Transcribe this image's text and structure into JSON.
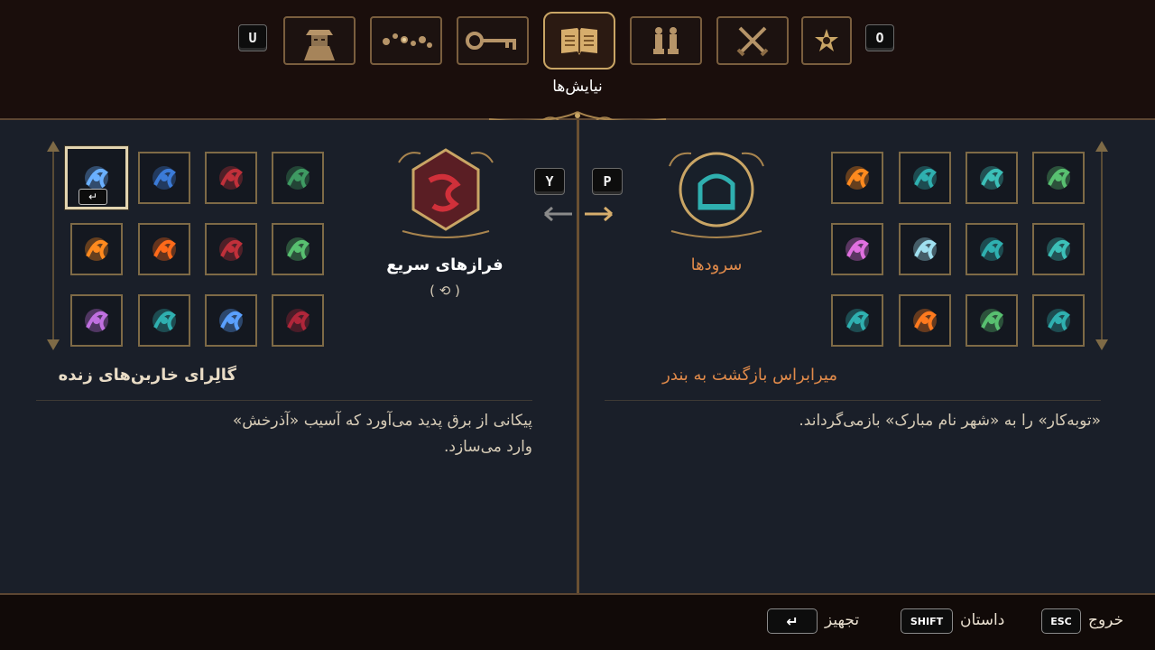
{
  "top_nav": {
    "left_key": "U",
    "right_key": "O",
    "active_title": "نیایش‌ها",
    "tabs": [
      {
        "icon": "portrait-icon"
      },
      {
        "icon": "rosary-icon"
      },
      {
        "icon": "key-icon"
      },
      {
        "icon": "book-icon"
      },
      {
        "icon": "figures-icon"
      },
      {
        "icon": "crossed-swords-icon"
      },
      {
        "icon": "star-emblem-icon"
      }
    ]
  },
  "swap": {
    "left_key": "Y",
    "right_key": "P"
  },
  "left_panel": {
    "emblem_label": "فرازهای سریع",
    "sub_label": "( ⟲ )",
    "section_title": "گالِرای خاربن‌های زنده",
    "description_line1": "پیکانی از برق پدید می‌آورد که آسیب «آذرخش»",
    "description_line2": "وارد می‌سازد.",
    "selected_badge": "↵",
    "slots": [
      {
        "icon": "lightning-bolt-icon",
        "color": "#6ab0ff"
      },
      {
        "icon": "blue-claw-icon",
        "color": "#3b7bd8"
      },
      {
        "icon": "red-ring-icon",
        "color": "#c0303a"
      },
      {
        "icon": "green-leaf-icon",
        "color": "#3e9a62"
      },
      {
        "icon": "fire-burst-icon",
        "color": "#ff8a1e"
      },
      {
        "icon": "fireballs-icon",
        "color": "#ff6a1a"
      },
      {
        "icon": "red-hat-icon",
        "color": "#c0303a"
      },
      {
        "icon": "green-spiral-icon",
        "color": "#58c070"
      },
      {
        "icon": "purple-spark-icon",
        "color": "#c070e0"
      },
      {
        "icon": "teal-crown-icon",
        "color": "#2fb0b0"
      },
      {
        "icon": "blue-stars-icon",
        "color": "#5aa0ff"
      },
      {
        "icon": "red-serpent-icon",
        "color": "#b0263a"
      }
    ]
  },
  "right_panel": {
    "emblem_label": "سرودها",
    "section_title": "میرابراس بازگشت به بندر",
    "description": "«توبه‌کار» را به «شهر نام مبارک» بازمی‌گرداند.",
    "slots": [
      {
        "icon": "candles-icon",
        "color": "#ff8a1e"
      },
      {
        "icon": "shrine-icon",
        "color": "#2fb0b0"
      },
      {
        "icon": "teal-bell-icon",
        "color": "#3cc0b8"
      },
      {
        "icon": "clover-icon",
        "color": "#58c070"
      },
      {
        "icon": "pink-pillar-icon",
        "color": "#e070e0"
      },
      {
        "icon": "zigzag-icon",
        "color": "#a0e0f0"
      },
      {
        "icon": "teal-slash-icon",
        "color": "#2fb0b0"
      },
      {
        "icon": "hourglass-icon",
        "color": "#3cc0b8"
      },
      {
        "icon": "teal-vortex-icon",
        "color": "#2fb0b0"
      },
      {
        "icon": "orange-tornado-icon",
        "color": "#ff7a1e"
      },
      {
        "icon": "green-gem-icon",
        "color": "#58c070"
      },
      {
        "icon": "teal-swirl-icon",
        "color": "#2fb0b0"
      }
    ]
  },
  "footer": {
    "exit_label": "خروج",
    "exit_key": "ESC",
    "story_label": "داستان",
    "story_key": "SHIFT",
    "equip_label": "تجهیز",
    "equip_key": "↵"
  },
  "colors": {
    "gold": "#c9a565",
    "panel": "#1a1f29",
    "header": "#1a0e0c",
    "left_title": "#e9dcc6",
    "right_title": "#e08a4a"
  }
}
